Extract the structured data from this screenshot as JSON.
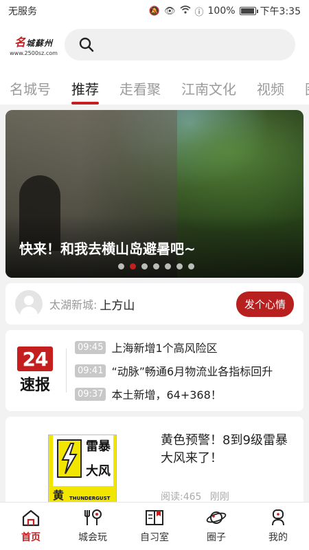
{
  "status": {
    "carrier": "无服务",
    "battery": "100%",
    "battery_level": 1.0,
    "time": "下午3:35"
  },
  "header": {
    "logo_char": "名",
    "logo_text": "城蘇州",
    "logo_url": "www.2500sz.com",
    "search_placeholder": ""
  },
  "tabs": [
    {
      "label": "名城号",
      "active": false
    },
    {
      "label": "推荐",
      "active": true
    },
    {
      "label": "走看聚",
      "active": false
    },
    {
      "label": "江南文化",
      "active": false
    },
    {
      "label": "视频",
      "active": false
    }
  ],
  "tab_partial": "图",
  "banner": {
    "title": "快来！和我去横山岛避暑吧~",
    "dots": 7,
    "active_dot": 1
  },
  "mood": {
    "place": "太湖新城:",
    "name": "上方山",
    "button": "发个心情"
  },
  "flash": {
    "logo_number": "24",
    "logo_word": "速报",
    "items": [
      {
        "time": "09:45",
        "text": "上海新增1个高风险区"
      },
      {
        "time": "09:41",
        "text": "“动脉”畅通6月物流业各指标回升"
      },
      {
        "time": "09:37",
        "text": "本土新增，64+368！"
      }
    ]
  },
  "article": {
    "title": "黄色预警！8到9级雷暴大风来了！",
    "reads": "阅读:465",
    "time": "刚刚",
    "image_text": {
      "chars": [
        "雷",
        "暴",
        "大",
        "风"
      ],
      "level": "黄",
      "en": "THUNDERGUST"
    }
  },
  "nav": [
    {
      "label": "首页",
      "icon": "home-icon",
      "active": true
    },
    {
      "label": "城会玩",
      "icon": "dining-icon",
      "active": false
    },
    {
      "label": "自习室",
      "icon": "book-icon",
      "active": false
    },
    {
      "label": "圈子",
      "icon": "planet-icon",
      "active": false
    },
    {
      "label": "我的",
      "icon": "profile-icon",
      "active": false
    }
  ],
  "colors": {
    "accent": "#c41e1e",
    "inactive_tab": "#9a9a9a"
  }
}
